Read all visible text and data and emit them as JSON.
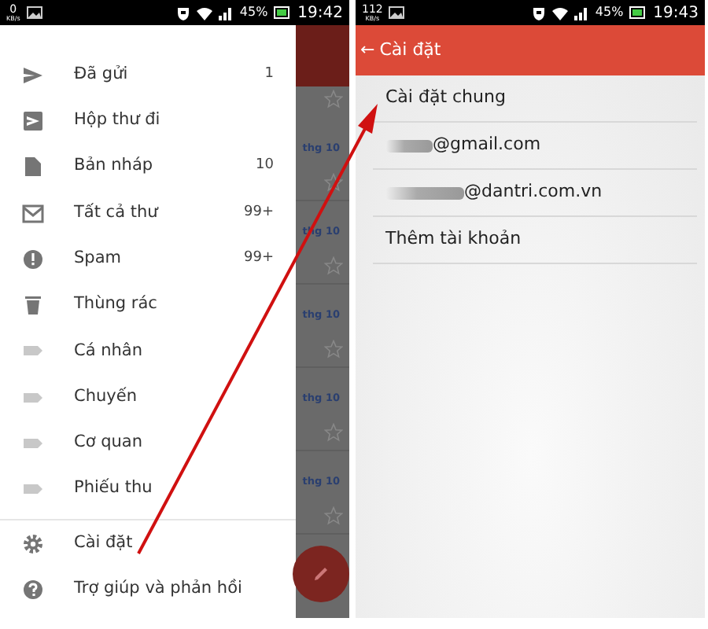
{
  "left_screen": {
    "status_bar": {
      "speed": "0",
      "speed_unit": "KB/s",
      "battery": "45%",
      "time": "19:42"
    },
    "drawer": {
      "items": [
        {
          "label": "Đã gửi",
          "count": "1"
        },
        {
          "label": "Hộp thư đi"
        },
        {
          "label": "Bản nháp",
          "count": "10"
        },
        {
          "label": "Tất cả thư",
          "count": "99+"
        },
        {
          "label": "Spam",
          "count": "99+"
        },
        {
          "label": "Thùng rác"
        },
        {
          "label": "Cá nhân"
        },
        {
          "label": "Chuyến"
        },
        {
          "label": "Cơ quan"
        },
        {
          "label": "Phiếu thu"
        }
      ],
      "footer_items": [
        {
          "label": "Cài đặt"
        },
        {
          "label": "Trợ giúp và phản hồi"
        }
      ]
    },
    "background_list": {
      "dates": [
        "thg 10",
        "thg 10",
        "thg 10",
        "thg 10",
        "thg 10"
      ]
    }
  },
  "right_screen": {
    "status_bar": {
      "speed": "112",
      "speed_unit": "KB/s",
      "battery": "45%",
      "time": "19:43"
    },
    "toolbar": {
      "back": "←",
      "title": "Cài đặt"
    },
    "items": [
      {
        "kind": "text",
        "label": "Cài đặt chung"
      },
      {
        "kind": "email",
        "label": "@gmail.com"
      },
      {
        "kind": "email",
        "label": "@dantri.com.vn"
      },
      {
        "kind": "text",
        "label": "Thêm tài khoản"
      }
    ]
  }
}
